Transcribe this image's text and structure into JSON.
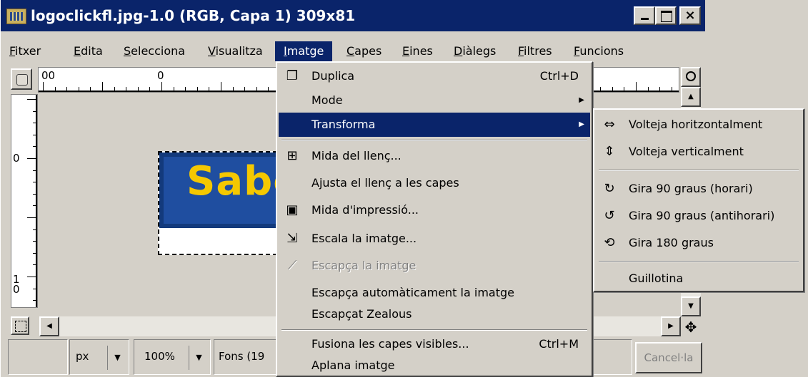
{
  "window": {
    "title": "logoclickfl.jpg-1.0 (RGB, Capa 1) 309x81"
  },
  "menubar": [
    "Fitxer",
    "Edita",
    "Selecciona",
    "Visualitza",
    "Imatge",
    "Capes",
    "Eines",
    "Diàlegs",
    "Filtres",
    "Funcions"
  ],
  "rulers": {
    "h_labels": [
      "00",
      "0"
    ],
    "v_labels": [
      "0",
      "1\n0"
    ]
  },
  "image": {
    "visible_text": "Sabo"
  },
  "statusbar": {
    "unit": "px",
    "zoom": "100%",
    "message": "Fons (19",
    "cancel": "Cancel·la"
  },
  "imatge_menu": [
    {
      "label": "Duplica",
      "shortcut": "Ctrl+D",
      "icon": "duplicate-icon"
    },
    {
      "label": "Mode",
      "submenu": true
    },
    {
      "label": "Transforma",
      "submenu": true,
      "active": true
    },
    {
      "label": "Mida del llenç...",
      "icon": "canvas-size-icon"
    },
    {
      "label": "Ajusta el llenç a les capes"
    },
    {
      "label": "Mida d'impressió...",
      "icon": "print-size-icon"
    },
    {
      "label": "Escala la imatge...",
      "icon": "scale-image-icon"
    },
    {
      "label": "Escapça la imatge",
      "disabled": true,
      "icon": "crop-icon"
    },
    {
      "label": "Escapça automàticament la imatge"
    },
    {
      "label": "Escapçat Zealous"
    },
    {
      "label": "Fusiona les capes visibles...",
      "shortcut": "Ctrl+M"
    },
    {
      "label": "Aplana imatge"
    }
  ],
  "transforma_menu": [
    {
      "label": "Volteja horitzontalment",
      "icon": "flip-horizontal-icon"
    },
    {
      "label": "Volteja verticalment",
      "icon": "flip-vertical-icon"
    },
    {
      "label": "Gira 90 graus (horari)",
      "icon": "rotate-cw-icon"
    },
    {
      "label": "Gira 90 graus (antihorari)",
      "icon": "rotate-ccw-icon"
    },
    {
      "label": "Gira 180 graus",
      "icon": "rotate-180-icon"
    },
    {
      "label": "Guillotina"
    }
  ]
}
